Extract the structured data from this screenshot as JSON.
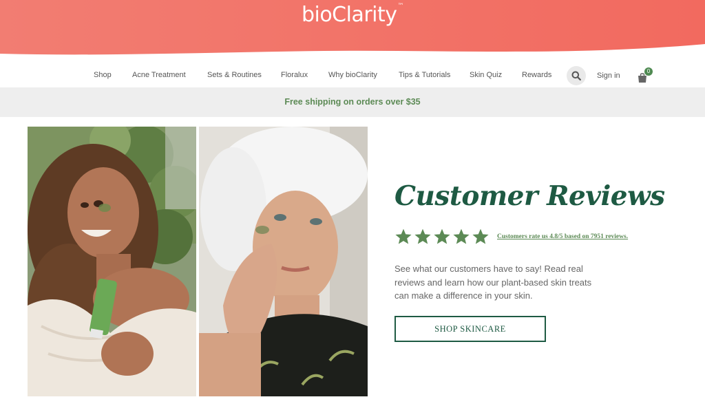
{
  "brand": {
    "logo": "bioClarity",
    "tm": "™",
    "color": "#f27368"
  },
  "nav": {
    "items": [
      "Shop",
      "Acne Treatment",
      "Sets & Routines",
      "Floralux",
      "Why bioClarity",
      "Tips & Tutorials",
      "Skin Quiz",
      "Rewards"
    ],
    "search_icon": "search-icon",
    "signin": "Sign in",
    "cart_icon": "shopping-bag-icon",
    "cart_count": "0"
  },
  "promo": {
    "text": "Free shipping on orders over $35",
    "color": "#5c8a55"
  },
  "hero": {
    "title": "Customer Reviews",
    "stars": 5,
    "rating_text": "Customers rate us 4.8/5 based on 7951 reviews.",
    "description": "See what our customers have to say! Read real reviews and learn how our plant-based skin treats can make a difference in your skin.",
    "cta": "SHOP SKINCARE",
    "accent": "#1e5a43",
    "star_color": "#5c8a55"
  }
}
